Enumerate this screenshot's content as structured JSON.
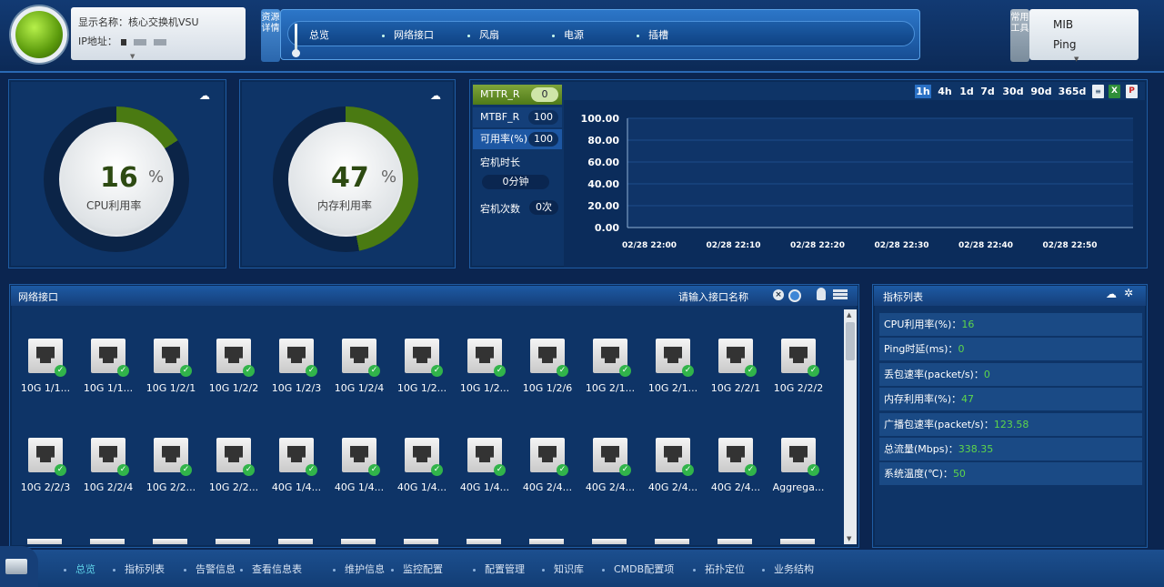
{
  "device": {
    "name_label": "显示名称：",
    "name_value": "核心交换机VSU",
    "ip_label": "IP地址："
  },
  "resource_tab": "资源详情",
  "nav": [
    "总览",
    "网络接口",
    "风扇",
    "电源",
    "插槽"
  ],
  "tools": {
    "tab": "常用工具",
    "items": [
      "MIB",
      "Ping"
    ]
  },
  "cpu": {
    "value": "16",
    "unit": "%",
    "label": "CPU利用率",
    "percent": 16
  },
  "mem": {
    "value": "47",
    "unit": "%",
    "label": "内存利用率",
    "percent": 47
  },
  "metrics": {
    "mttr_label": "MTTR_R",
    "mttr_value": "0",
    "mtbf_label": "MTBF_R",
    "mtbf_value": "100",
    "avail_label": "可用率(%)",
    "avail_value": "100",
    "down_time_label": "宕机时长",
    "down_time_value": "0分钟",
    "down_count_label": "宕机次数",
    "down_count_value": "0次"
  },
  "time_ranges": [
    "1h",
    "4h",
    "1d",
    "7d",
    "30d",
    "90d",
    "365d"
  ],
  "chart_data": {
    "type": "line",
    "y_ticks": [
      "100.00",
      "80.00",
      "60.00",
      "40.00",
      "20.00",
      "0.00"
    ],
    "x_ticks": [
      "02/28 22:00",
      "02/28 22:10",
      "02/28 22:20",
      "02/28 22:30",
      "02/28 22:40",
      "02/28 22:50"
    ],
    "ylim": [
      0,
      100
    ],
    "series": []
  },
  "interfaces": {
    "title": "网络接口",
    "search_placeholder": "请输入接口名称",
    "ports": [
      "10G 1/1...",
      "10G 1/1...",
      "10G 1/2/1",
      "10G 1/2/2",
      "10G 1/2/3",
      "10G 1/2/4",
      "10G 1/2...",
      "10G 1/2...",
      "10G 1/2/6",
      "10G 2/1...",
      "10G 2/1...",
      "10G 2/2/1",
      "10G 2/2/2",
      "10G 2/2/3",
      "10G 2/2/4",
      "10G 2/2...",
      "10G 2/2...",
      "40G 1/4...",
      "40G 1/4...",
      "40G 1/4...",
      "40G 1/4...",
      "40G 2/4...",
      "40G 2/4...",
      "40G 2/4...",
      "40G 2/4...",
      "Aggrega..."
    ]
  },
  "indicators": {
    "title": "指标列表",
    "rows": [
      {
        "label": "CPU利用率(%)：",
        "value": "16"
      },
      {
        "label": "Ping时延(ms)：",
        "value": "0"
      },
      {
        "label": "丢包速率(packet/s)：",
        "value": "0"
      },
      {
        "label": "内存利用率(%)：",
        "value": "47"
      },
      {
        "label": "广播包速率(packet/s)：",
        "value": "123.58"
      },
      {
        "label": "总流量(Mbps)：",
        "value": "338.35"
      },
      {
        "label": "系统温度(℃)：",
        "value": "50"
      }
    ]
  },
  "footer": [
    "总览",
    "指标列表",
    "告警信息",
    "查看信息表",
    "维护信息",
    "监控配置",
    "配置管理",
    "知识库",
    "CMDB配置项",
    "拓扑定位",
    "业务结构"
  ],
  "colors": {
    "accent_green": "#5ed64b",
    "gauge_green": "#4a7a12",
    "status_ok": "#31b44a"
  }
}
